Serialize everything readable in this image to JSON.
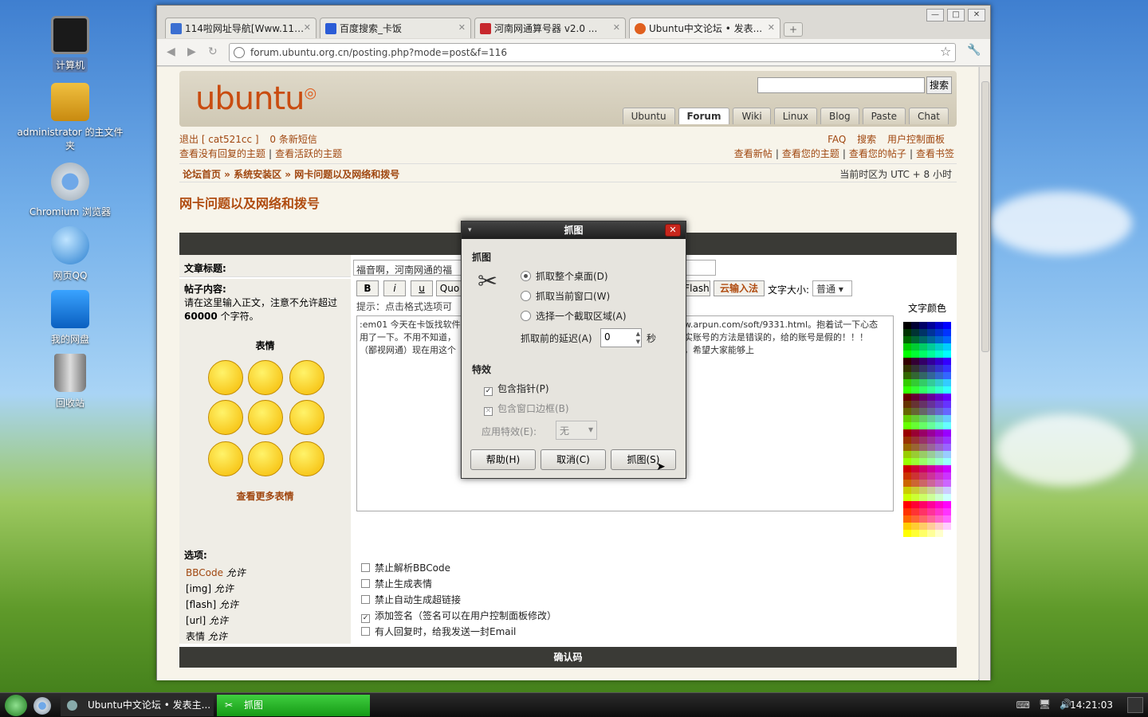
{
  "desktop": {
    "icons": [
      {
        "label": "计算机",
        "icon": "computer-icon",
        "selected": true
      },
      {
        "label": "administrator 的主文件夹",
        "icon": "home-folder-icon",
        "selected": false
      },
      {
        "label": "Chromium 浏览器",
        "icon": "chromium-icon",
        "selected": false
      },
      {
        "label": "网页QQ",
        "icon": "qq-icon",
        "selected": false
      },
      {
        "label": "我的网盘",
        "icon": "netdisk-icon",
        "selected": false
      },
      {
        "label": "回收站",
        "icon": "trash-icon",
        "selected": false
      }
    ]
  },
  "browser": {
    "tabs": [
      {
        "label": "114啦网址导航[Www.11…",
        "color": "#3b6fd1"
      },
      {
        "label": "百度搜索_卡饭",
        "color": "#2b5cd6"
      },
      {
        "label": "河南网通算号器 v2.0 ...",
        "color": "#c7282d"
      },
      {
        "label": "Ubuntu中文论坛 • 发表...",
        "color": "#e0601f"
      }
    ],
    "url": "forum.ubuntu.org.cn/posting.php?mode=post&f=116"
  },
  "forum": {
    "logo": "ubuntu",
    "search_button": "搜索",
    "nav_tabs": [
      "Ubuntu",
      "Forum",
      "Wiki",
      "Linux",
      "Blog",
      "Paste",
      "Chat"
    ],
    "user_links": {
      "logout": "退出 [ cat521cc ]",
      "pm": "0 条新短信",
      "faq": "FAQ",
      "search": "搜索",
      "ucp": "用户控制面板"
    },
    "left_links": [
      "查看没有回复的主题",
      "查看活跃的主题"
    ],
    "right_links": [
      "查看新帖",
      "查看您的主题",
      "查看您的帖子",
      "查看书签"
    ],
    "breadcrumb": "论坛首页 » 系统安装区 » 网卡问题以及网络和拨号",
    "timezone": "当前时区为 UTC + 8 小时",
    "page_title": "网卡问题以及网络和拨号",
    "subject_label": "文章标题:",
    "subject_value": "福音啊，河南网通的福",
    "body_label": "帖子内容:",
    "body_hint": "请在这里输入正文，注意不允许超过",
    "body_limit": "60000",
    "body_limit_suffix": "个字符。",
    "smilies_title": "表情",
    "more_smilies": "查看更多表情",
    "fmt_buttons": [
      "B",
      "i",
      "u",
      "Quo"
    ],
    "flash_btn": "Flash",
    "cloud_input": "云输入法",
    "font_size_label": "文字大小:",
    "font_size_value": "普通",
    "hint_line": "提示：点击格式选项可",
    "text_color_label": "文字颜色",
    "body_text_1": ":em01 今天在卡饭找软件",
    "body_text_1b": "w.arpun.com/soft/9331.html。抱着试一下心态",
    "body_text_2": "用了一下。不用不知道，",
    "body_text_2b": "实账号的方法是错误的，给的账号是假的！！！",
    "body_text_3": "（鄙视网通）现在用这个",
    "body_text_3b": "，希望大家能够上",
    "options_title": "选项:",
    "options_left": [
      {
        "name": "BBCode",
        "state": "允许"
      },
      {
        "name": "[img]",
        "state": "允许"
      },
      {
        "name": "[flash]",
        "state": "允许"
      },
      {
        "name": "[url]",
        "state": "允许"
      },
      {
        "name": "表情",
        "state": "允许"
      }
    ],
    "options_right": [
      {
        "label": "禁止解析BBCode",
        "checked": false
      },
      {
        "label": "禁止生成表情",
        "checked": false
      },
      {
        "label": "禁止自动生成超链接",
        "checked": false
      },
      {
        "label": "添加签名（签名可以在用户控制面板修改）",
        "checked": true
      },
      {
        "label": "有人回复时，给我发送一封Email",
        "checked": false
      }
    ],
    "confirm_title": "确认码"
  },
  "dialog": {
    "title": "抓图",
    "section_capture": "抓图",
    "radio_desktop": "抓取整个桌面(D)",
    "radio_window": "抓取当前窗口(W)",
    "radio_area": "选择一个截取区域(A)",
    "delay_label": "抓取前的延迟(A)",
    "delay_value": "0",
    "delay_unit": "秒",
    "section_effects": "特效",
    "include_pointer": "包含指针(P)",
    "include_border": "包含窗口边框(B)",
    "apply_effect_label": "应用特效(E):",
    "apply_effect_value": "无",
    "btn_help": "帮助(H)",
    "btn_cancel": "取消(C)",
    "btn_capture": "抓图(S)"
  },
  "taskbar": {
    "tasks": [
      "Ubuntu中文论坛 • 发表主...",
      "抓图"
    ],
    "clock": "14:21:03"
  }
}
